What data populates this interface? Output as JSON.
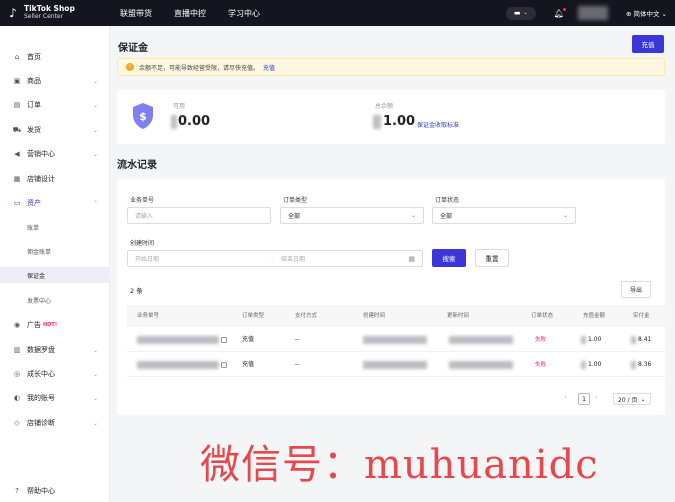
{
  "brand": {
    "line1": "TikTok Shop",
    "line2": "Seller Center"
  },
  "topnav": [
    "联盟带货",
    "直播中控",
    "学习中心"
  ],
  "top_right": {
    "message_icon": "message-icon",
    "language": "简体中文"
  },
  "sidebar": {
    "items": [
      {
        "label": "首页",
        "icon": "home-icon"
      },
      {
        "label": "商品",
        "icon": "box-icon"
      },
      {
        "label": "订单",
        "icon": "order-icon"
      },
      {
        "label": "发货",
        "icon": "truck-icon"
      },
      {
        "label": "营销中心",
        "icon": "megaphone-icon"
      },
      {
        "label": "店铺设计",
        "icon": "store-icon"
      },
      {
        "label": "资产",
        "icon": "wallet-icon"
      },
      {
        "label": "广告",
        "icon": "ad-icon",
        "badge": "HOT!"
      },
      {
        "label": "数据罗盘",
        "icon": "compass-icon"
      },
      {
        "label": "成长中心",
        "icon": "growth-icon"
      },
      {
        "label": "我的账号",
        "icon": "account-icon"
      },
      {
        "label": "店铺诊断",
        "icon": "diagnosis-icon"
      },
      {
        "label": "帮助中心",
        "icon": "help-icon"
      }
    ],
    "asset_subitems": [
      "账单",
      "佣金账单",
      "保证金",
      "发票中心"
    ]
  },
  "page": {
    "title": "保证金",
    "recharge_button": "充值",
    "alert_text": "余额不足，可能导致经营受限，请尽快充值。",
    "alert_link": "充值"
  },
  "balance": {
    "available_label": "可用",
    "available_value": "0.00",
    "total_label": "总余额",
    "total_value": "1.00",
    "standard_link": "保证金收取标准"
  },
  "records": {
    "section_title": "流水记录",
    "filters": {
      "business_no_label": "业务单号",
      "business_no_placeholder": "请输入",
      "order_type_label": "订单类型",
      "order_type_value": "全部",
      "order_status_label": "订单状态",
      "order_status_value": "全部",
      "created_time_label": "创建时间",
      "start_placeholder": "开始日期",
      "end_placeholder": "结束日期",
      "date_separator": "-",
      "search_button": "搜索",
      "reset_button": "重置"
    },
    "count_text": "2 条",
    "export_button": "导出",
    "columns": [
      "业务单号",
      "订单类型",
      "支付方式",
      "创建时间",
      "更新时间",
      "订单状态",
      "充值金额",
      "实付金"
    ],
    "rows": [
      {
        "order_type": "充值",
        "payment": "--",
        "status": "失败",
        "amount": "1.00",
        "paid": "8.41"
      },
      {
        "order_type": "充值",
        "payment": "--",
        "status": "失败",
        "amount": "1.00",
        "paid": "8.36"
      }
    ],
    "pagination": {
      "current_page": "1",
      "page_size": "20 / 页"
    }
  },
  "watermark": "微信号：muhuanidc"
}
